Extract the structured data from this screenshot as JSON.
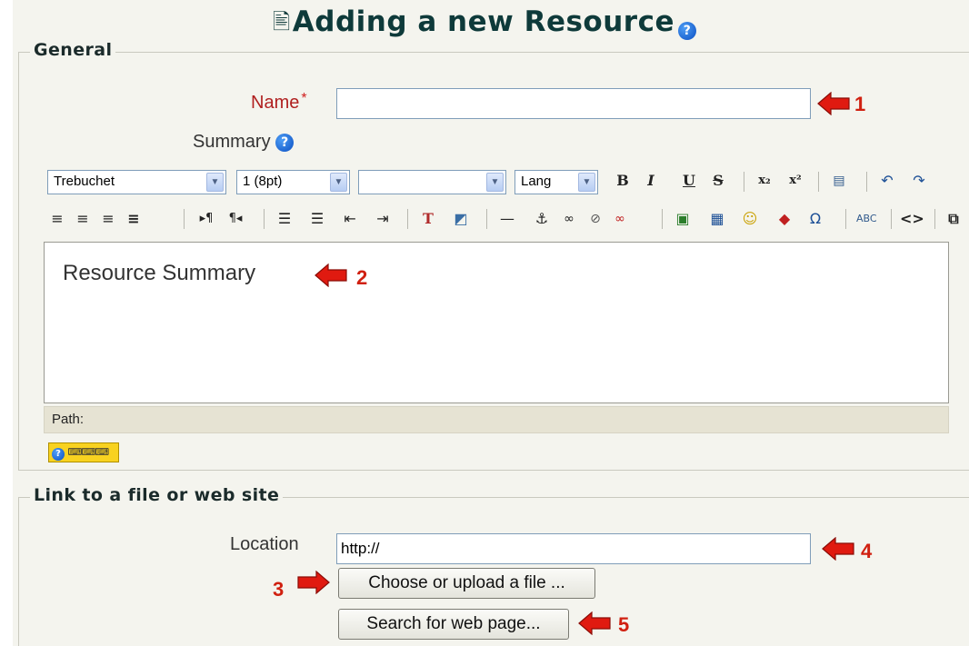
{
  "page": {
    "title": "Adding a new Resource",
    "title_doc_icon": "document-icon",
    "help_glyph": "?"
  },
  "general": {
    "legend": "General",
    "name_label": "Name",
    "required_mark": "*",
    "name_value": "",
    "summary_label": "Summary",
    "toolbar": {
      "font_family": "Trebuchet",
      "font_size": "1 (8pt)",
      "style_value": "",
      "lang": "Lang",
      "bold": "B",
      "italic": "I",
      "underline": "U",
      "strikethrough": "S",
      "subscript": "x₂",
      "superscript": "x²"
    },
    "editor_content": "Resource Summary",
    "path_label": "Path:",
    "keyboard_help": "?"
  },
  "link": {
    "legend": "Link to a file or web site",
    "location_label": "Location",
    "location_value": "http://",
    "choose_button": "Choose or upload a file ...",
    "search_button": "Search for web page..."
  },
  "annotations": [
    "1",
    "2",
    "3",
    "4",
    "5"
  ],
  "colors": {
    "arrow": "#e01a10",
    "title": "#0e3a3a",
    "required": "#b01f1f",
    "panel_bg": "#f4f4ee"
  }
}
